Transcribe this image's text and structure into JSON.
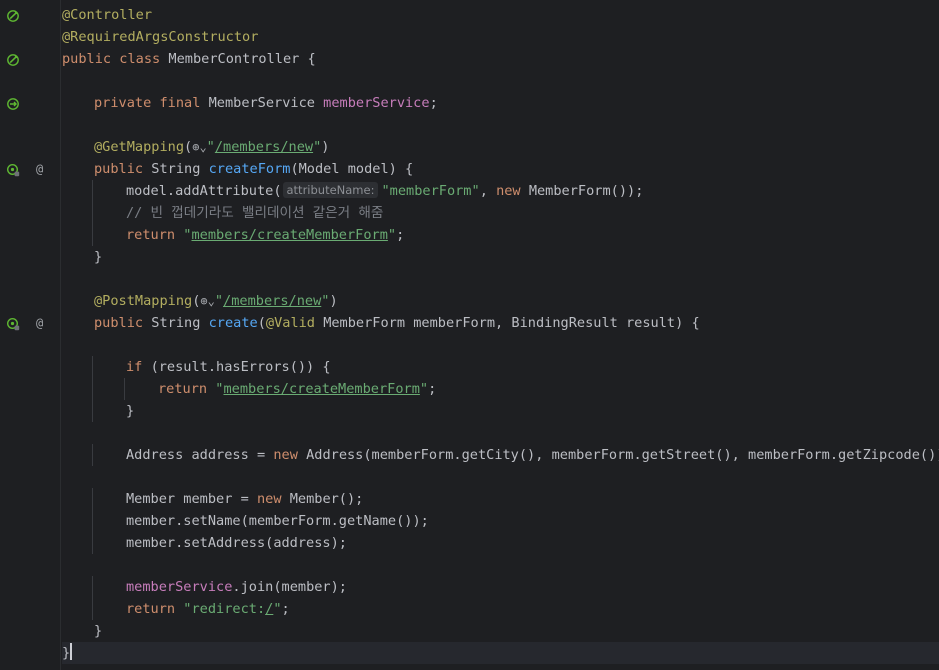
{
  "editor": {
    "language": "java",
    "lines": [
      {
        "indent": 0,
        "tokens": [
          [
            "ann",
            "@Controller"
          ]
        ]
      },
      {
        "indent": 0,
        "tokens": [
          [
            "ann",
            "@RequiredArgsConstructor"
          ]
        ]
      },
      {
        "indent": 0,
        "tokens": [
          [
            "kw",
            "public class "
          ],
          [
            "plain",
            "MemberController {"
          ]
        ]
      },
      {
        "indent": 0,
        "tokens": []
      },
      {
        "indent": 1,
        "tokens": [
          [
            "kw",
            "private final "
          ],
          [
            "plain",
            "MemberService "
          ],
          [
            "field",
            "memberService"
          ],
          [
            "plain",
            ";"
          ]
        ]
      },
      {
        "indent": 0,
        "tokens": []
      },
      {
        "indent": 1,
        "tokens": [
          [
            "ann",
            "@GetMapping"
          ],
          [
            "plain",
            "("
          ],
          [
            "icon",
            "⊕⌄"
          ],
          [
            "str",
            "\""
          ],
          [
            "str_u",
            "/members/new"
          ],
          [
            "str",
            "\""
          ],
          [
            "plain",
            ")"
          ]
        ]
      },
      {
        "indent": 1,
        "tokens": [
          [
            "kw",
            "public "
          ],
          [
            "plain",
            "String "
          ],
          [
            "fn",
            "createForm"
          ],
          [
            "plain",
            "(Model model) {"
          ]
        ]
      },
      {
        "indent": 2,
        "tokens": [
          [
            "plain",
            "model.addAttribute("
          ],
          [
            "hint",
            "attributeName:"
          ],
          [
            "str",
            "\"memberForm\""
          ],
          [
            "plain",
            ", "
          ],
          [
            "kw",
            "new "
          ],
          [
            "plain",
            "MemberForm());"
          ]
        ]
      },
      {
        "indent": 2,
        "tokens": [
          [
            "cmt",
            "// 빈 껍데기라도 밸리데이션 같은거 해줌"
          ]
        ]
      },
      {
        "indent": 2,
        "tokens": [
          [
            "kw",
            "return "
          ],
          [
            "str",
            "\""
          ],
          [
            "str_u",
            "members/createMemberForm"
          ],
          [
            "str",
            "\""
          ],
          [
            "plain",
            ";"
          ]
        ]
      },
      {
        "indent": 1,
        "tokens": [
          [
            "plain",
            "}"
          ]
        ]
      },
      {
        "indent": 0,
        "tokens": []
      },
      {
        "indent": 1,
        "tokens": [
          [
            "ann",
            "@PostMapping"
          ],
          [
            "plain",
            "("
          ],
          [
            "icon",
            "⊕⌄"
          ],
          [
            "str",
            "\""
          ],
          [
            "str_u",
            "/members/new"
          ],
          [
            "str",
            "\""
          ],
          [
            "plain",
            ")"
          ]
        ]
      },
      {
        "indent": 1,
        "tokens": [
          [
            "kw",
            "public "
          ],
          [
            "plain",
            "String "
          ],
          [
            "fn",
            "create"
          ],
          [
            "plain",
            "("
          ],
          [
            "ann",
            "@Valid "
          ],
          [
            "plain",
            "MemberForm memberForm, BindingResult result) {"
          ]
        ]
      },
      {
        "indent": 0,
        "tokens": []
      },
      {
        "indent": 2,
        "tokens": [
          [
            "kw",
            "if "
          ],
          [
            "plain",
            "(result.hasErrors()) {"
          ]
        ]
      },
      {
        "indent": 3,
        "tokens": [
          [
            "kw",
            "return "
          ],
          [
            "str",
            "\""
          ],
          [
            "str_u",
            "members/createMemberForm"
          ],
          [
            "str",
            "\""
          ],
          [
            "plain",
            ";"
          ]
        ]
      },
      {
        "indent": 2,
        "tokens": [
          [
            "plain",
            "}"
          ]
        ]
      },
      {
        "indent": 0,
        "tokens": []
      },
      {
        "indent": 2,
        "tokens": [
          [
            "plain",
            "Address address = "
          ],
          [
            "kw",
            "new "
          ],
          [
            "plain",
            "Address(memberForm.getCity(), memberForm.getStreet(), memberForm.getZipcode());"
          ]
        ]
      },
      {
        "indent": 0,
        "tokens": []
      },
      {
        "indent": 2,
        "tokens": [
          [
            "plain",
            "Member member = "
          ],
          [
            "kw",
            "new "
          ],
          [
            "plain",
            "Member();"
          ]
        ]
      },
      {
        "indent": 2,
        "tokens": [
          [
            "plain",
            "member.setName(memberForm.getName());"
          ]
        ]
      },
      {
        "indent": 2,
        "tokens": [
          [
            "plain",
            "member.setAddress(address);"
          ]
        ]
      },
      {
        "indent": 0,
        "tokens": []
      },
      {
        "indent": 2,
        "tokens": [
          [
            "field",
            "memberService"
          ],
          [
            "plain",
            ".join(member);"
          ]
        ]
      },
      {
        "indent": 2,
        "tokens": [
          [
            "kw",
            "return "
          ],
          [
            "str",
            "\"redirect:"
          ],
          [
            "str_u",
            "/"
          ],
          [
            "str",
            "\""
          ],
          [
            "plain",
            ";"
          ]
        ]
      },
      {
        "indent": 1,
        "tokens": [
          [
            "plain",
            "}"
          ]
        ]
      },
      {
        "indent": 0,
        "tokens": [
          [
            "plain",
            "}"
          ],
          [
            "caret",
            ""
          ]
        ],
        "current": true
      }
    ]
  },
  "gutter_icons": [
    {
      "line": 0,
      "icon": "spring-bean-icon"
    },
    {
      "line": 2,
      "icon": "spring-bean-icon"
    },
    {
      "line": 4,
      "icon": "spring-injection-icon"
    },
    {
      "line": 7,
      "icon": "spring-request-mapping-icon",
      "at": true
    },
    {
      "line": 14,
      "icon": "spring-request-mapping-icon",
      "at": true
    }
  ],
  "colors": {
    "background": "#1e1f22",
    "keyword": "#cf8e6d",
    "annotation": "#b3ae60",
    "string": "#6aab73",
    "field": "#c77dbb",
    "function": "#56a8f5",
    "comment": "#7a7e85",
    "text": "#bcbec4",
    "gutter_icon": "#5fb832"
  }
}
